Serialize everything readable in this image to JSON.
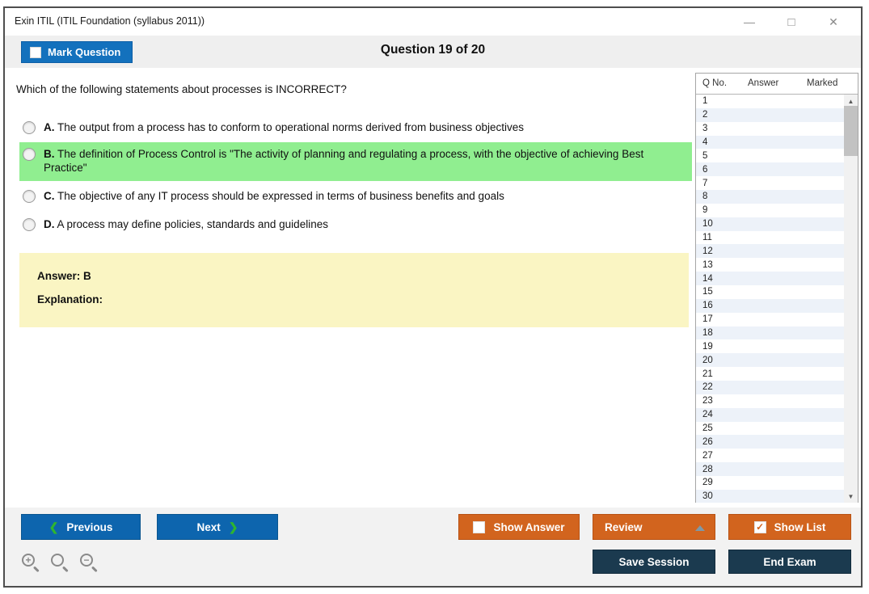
{
  "window": {
    "title": "Exin ITIL (ITIL Foundation (syllabus 2011))",
    "controls": {
      "minimize": "—",
      "maximize": "□",
      "close": "✕"
    }
  },
  "header": {
    "mark_question_label": "Mark Question",
    "question_counter": "Question 19 of 20"
  },
  "question": {
    "text": "Which of the following statements about processes is INCORRECT?",
    "options": [
      {
        "letter": "A.",
        "text": "The output from a process has to conform to operational norms derived from business objectives",
        "highlighted": false
      },
      {
        "letter": "B.",
        "text": "The definition of Process Control is \"The activity of planning and regulating a process, with the objective of achieving Best Practice\"",
        "highlighted": true
      },
      {
        "letter": "C.",
        "text": "The objective of any IT process should be expressed in terms of business benefits and goals",
        "highlighted": false
      },
      {
        "letter": "D.",
        "text": "A process may define policies, standards and guidelines",
        "highlighted": false
      }
    ],
    "answer_label": "Answer: B",
    "explanation_label": "Explanation:"
  },
  "question_list": {
    "columns": [
      "Q No.",
      "Answer",
      "Marked"
    ],
    "rows": [
      "1",
      "2",
      "3",
      "4",
      "5",
      "6",
      "7",
      "8",
      "9",
      "10",
      "11",
      "12",
      "13",
      "14",
      "15",
      "16",
      "17",
      "18",
      "19",
      "20",
      "21",
      "22",
      "23",
      "24",
      "25",
      "26",
      "27",
      "28",
      "29",
      "30"
    ],
    "scroll_up_glyph": "▲",
    "scroll_down_glyph": "▼"
  },
  "footer": {
    "previous_label": "Previous",
    "next_label": "Next",
    "prev_chevron": "❮",
    "next_chevron": "❯",
    "show_answer_label": "Show Answer",
    "show_answer_checked": false,
    "review_label": "Review",
    "show_list_label": "Show List",
    "show_list_checked": true,
    "show_list_check_glyph": "✓",
    "save_session_label": "Save Session",
    "end_exam_label": "End Exam",
    "zoom_in_glyph": "+",
    "zoom_out_glyph": "−"
  },
  "colors": {
    "accent_blue": "#0d65ae",
    "mark_blue": "#1371bd",
    "accent_orange": "#d2641e",
    "navy": "#1b3a4f",
    "highlight_green": "#90ee90",
    "answer_yellow": "#faf5c3",
    "row_alt_blue": "#edf2f9",
    "chevron_green": "#2fb52f"
  }
}
